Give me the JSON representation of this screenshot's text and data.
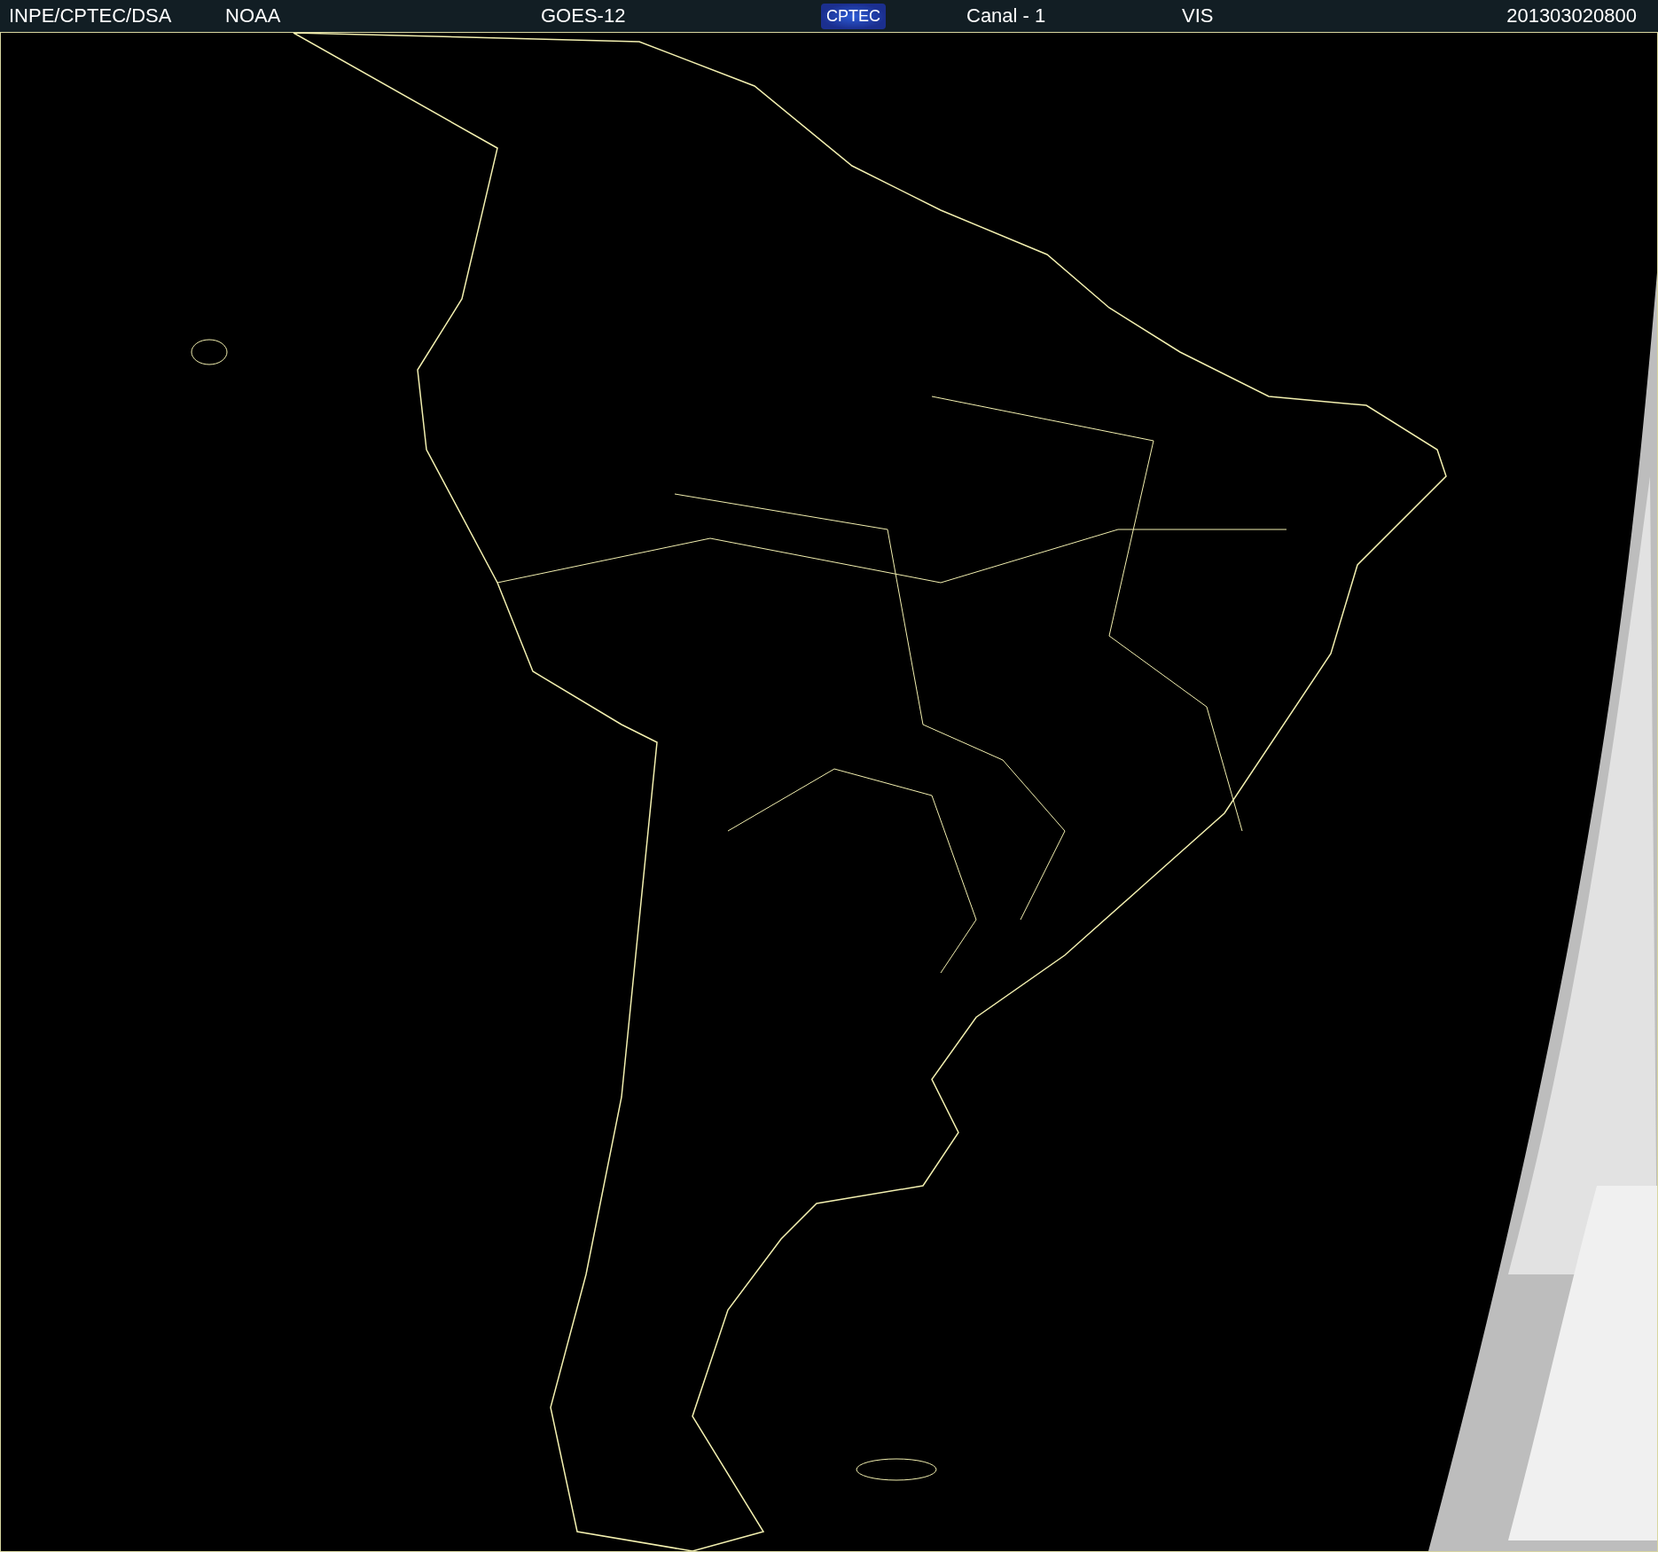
{
  "header": {
    "items": [
      {
        "kind": "text",
        "text": "INPE/CPTEC/DSA"
      },
      {
        "kind": "text",
        "text": "NOAA"
      },
      {
        "kind": "text",
        "text": "GOES-12"
      },
      {
        "kind": "logo",
        "text": "CPTEC"
      },
      {
        "kind": "text",
        "text": "Canal - 1"
      },
      {
        "kind": "text",
        "text": "VIS"
      },
      {
        "kind": "text",
        "text": "201303020800"
      }
    ]
  }
}
